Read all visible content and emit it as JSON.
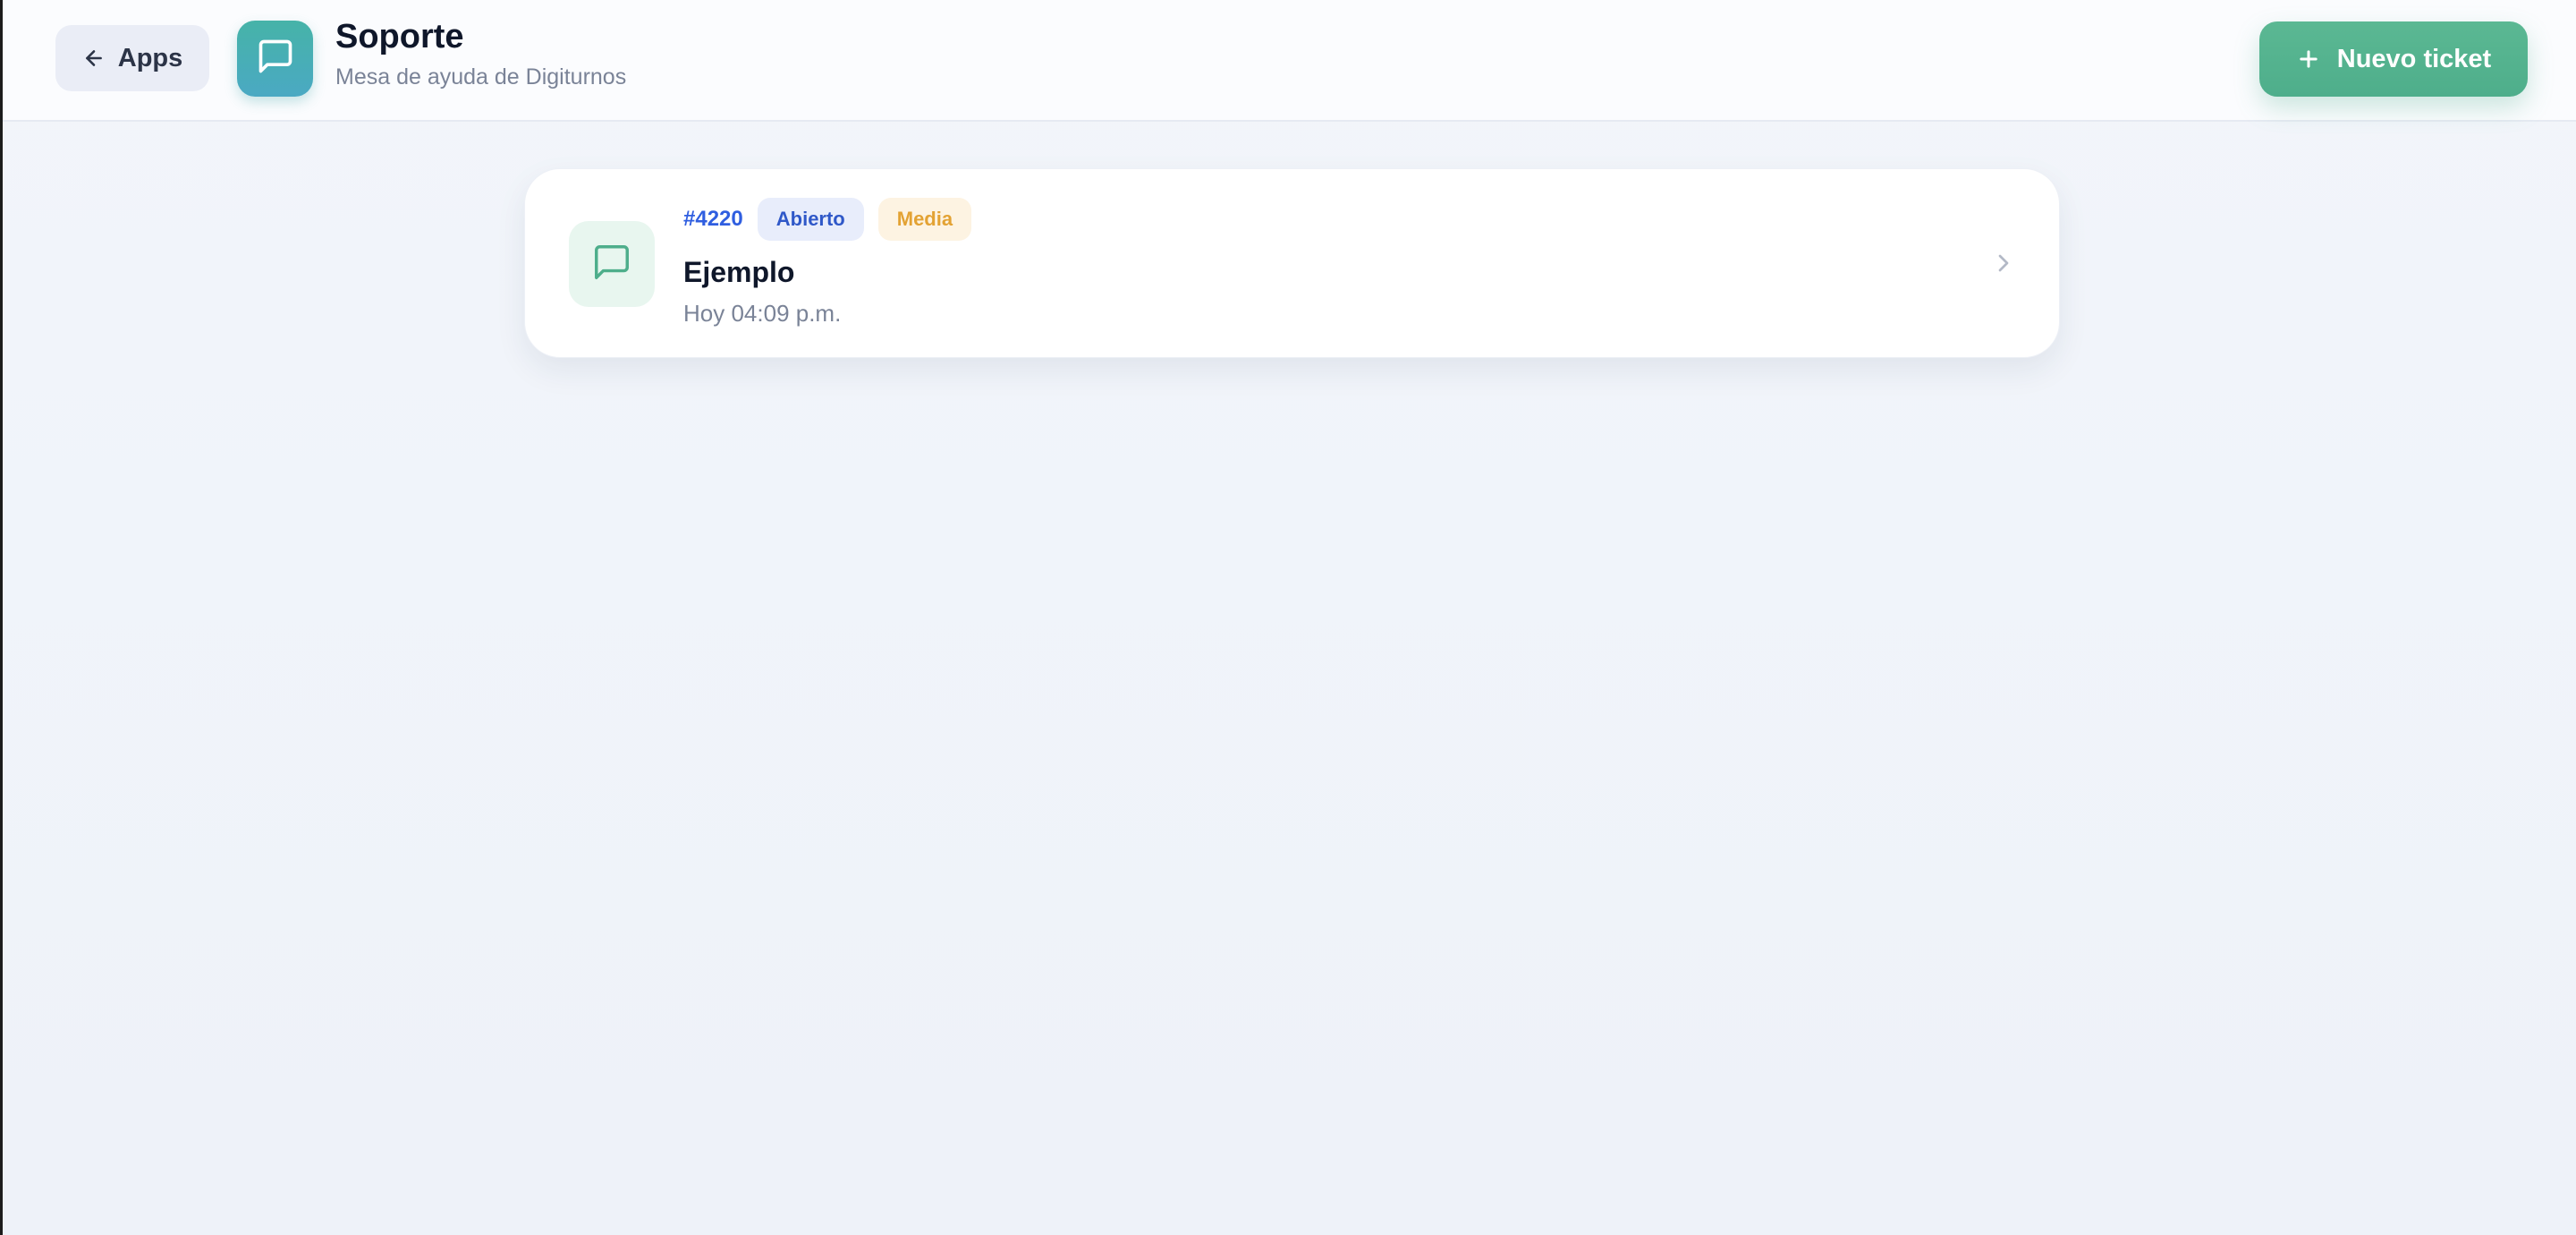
{
  "header": {
    "back_label": "Apps",
    "app_title": "Soporte",
    "app_subtitle": "Mesa de ayuda de Digiturnos",
    "new_ticket_label": "Nuevo ticket"
  },
  "tickets": [
    {
      "id": "#4220",
      "status": "Abierto",
      "priority": "Media",
      "title": "Ejemplo",
      "time": "Hoy 04:09 p.m."
    }
  ],
  "icons": {
    "back": "arrow-left-icon",
    "app": "message-square-icon",
    "new_ticket": "plus-icon",
    "ticket": "message-square-icon",
    "open": "chevron-right-icon"
  },
  "colors": {
    "accent_green": "#4eae8b",
    "app_icon_teal": "#46b3a8",
    "ticket_id_blue": "#2f5ee0",
    "status_blue": "#2f58c8",
    "priority_amber": "#e3a233",
    "title_dark": "#0f172a",
    "muted_text": "#7a8397"
  }
}
